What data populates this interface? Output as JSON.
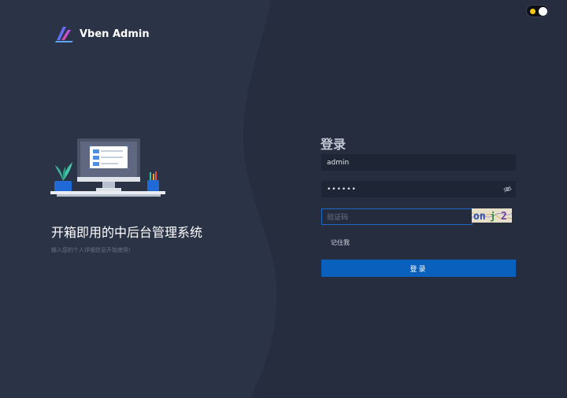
{
  "app": {
    "title": "Vben Admin"
  },
  "banner": {
    "slogan": "开箱即用的中后台管理系统",
    "subtitle": "输入您的个人详细信息开始使用！"
  },
  "login": {
    "title": "登录",
    "username": {
      "value": "admin"
    },
    "password": {
      "value": "••••••"
    },
    "captcha": {
      "placeholder": "验证码",
      "image_text": "on 2"
    },
    "remember_label": "记住我",
    "submit_label": "登录"
  },
  "theme": {
    "mode": "dark"
  },
  "colors": {
    "background": "#252d3f",
    "panel": "#1e2535",
    "primary": "#0960bd",
    "focus_border": "#1f68c4"
  },
  "icons": {
    "logo": "vben-logo-icon",
    "password_toggle": "eye-off-icon",
    "theme": "sun-icon"
  }
}
